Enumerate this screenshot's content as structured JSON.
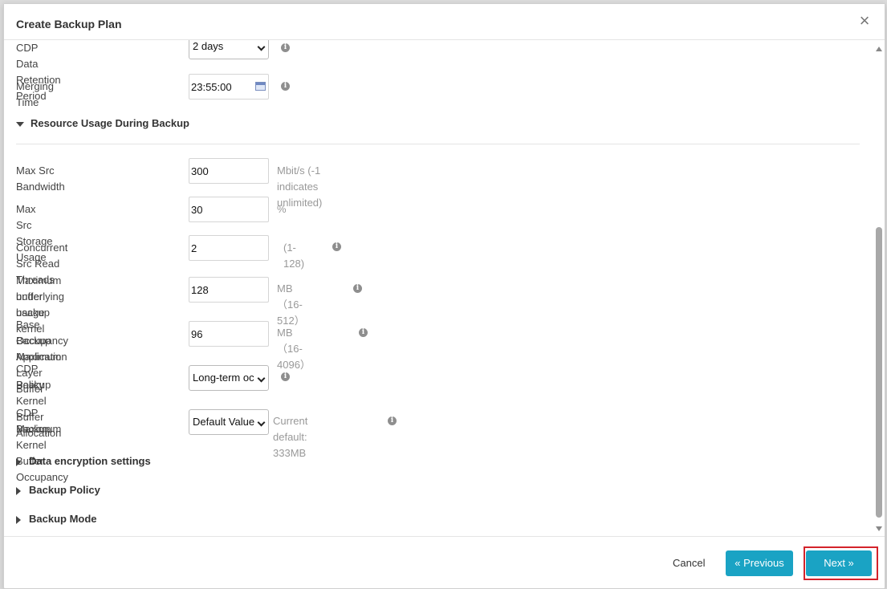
{
  "dialog": {
    "title": "Create Backup Plan",
    "close_icon": "×"
  },
  "fields": {
    "cdp_retention": {
      "label": "CDP Data Retention Period",
      "value": "2 days"
    },
    "merging_time": {
      "label": "Merging Time",
      "value": "23:55:00"
    },
    "resource_section": {
      "label": "Resource Usage During Backup"
    },
    "max_src_bandwidth": {
      "label": "Max Src Bandwidth",
      "value": "300",
      "hint": "Mbit/s (-1 indicates unlimited)"
    },
    "max_src_storage": {
      "label": "Max Src Storage Usage",
      "value": "30",
      "hint": "%"
    },
    "concurrent_threads": {
      "label": "Concurrent Src Read Threads",
      "value": "2",
      "hint": "(1-128)"
    },
    "kernel_buffer": {
      "label_line1": "Maximum underlying backup kernel",
      "label_line2": "buffer usage",
      "value": "128",
      "hint": "MB（16-512）"
    },
    "app_buffer": {
      "label_line1": "Base Backup Application Layer Buffer",
      "label_line2": "Occupancy Maximum",
      "value": "96",
      "hint": "MB（16-4096）"
    },
    "cdp_alloc_policy": {
      "label_line1": "CDP Backup Kernel Buffer Allocation",
      "label_line2": "Policy",
      "value": "Long-term oc"
    },
    "cdp_occupancy_max": {
      "label_line1": "CDP Backup Kernel Buffer Occupancy",
      "label_line2": "Maximum",
      "value": "Default Value",
      "hint": "Current default: 333MB"
    }
  },
  "sections": {
    "encryption": "Data encryption settings",
    "policy": "Backup Policy",
    "mode": "Backup Mode"
  },
  "footer": {
    "cancel": "Cancel",
    "previous": "« Previous",
    "next": "Next »"
  },
  "colors": {
    "primary": "#1aa3c4",
    "highlight": "#d4232b"
  }
}
